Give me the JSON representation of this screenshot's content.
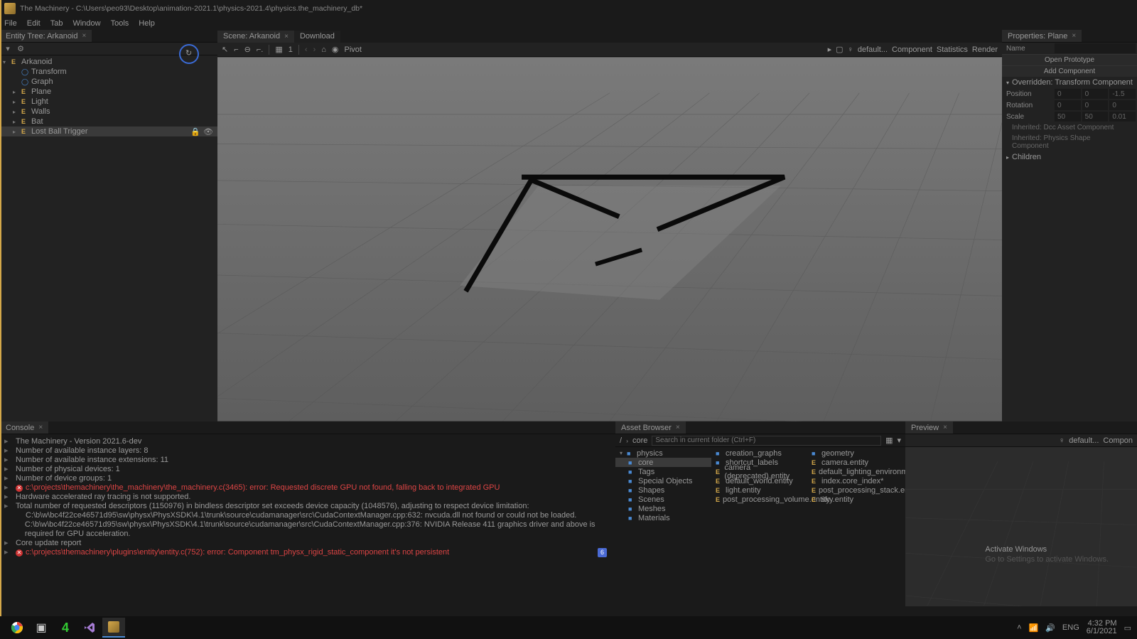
{
  "window": {
    "title": "The Machinery - C:\\Users\\peo93\\Desktop\\animation-2021.1\\physics-2021.4\\physics.the_machinery_db*"
  },
  "menu": [
    "File",
    "Edit",
    "Tab",
    "Window",
    "Tools",
    "Help"
  ],
  "entity_tree": {
    "tab_label": "Entity Tree: Arkanoid",
    "root": "Arkanoid",
    "items": [
      {
        "label": "Transform",
        "icon": "g",
        "indent": 1
      },
      {
        "label": "Graph",
        "icon": "g",
        "indent": 1
      },
      {
        "label": "Plane",
        "icon": "e",
        "indent": 1,
        "expand": true
      },
      {
        "label": "Light",
        "icon": "e",
        "indent": 1,
        "expand": true
      },
      {
        "label": "Walls",
        "icon": "e",
        "indent": 1,
        "expand": true
      },
      {
        "label": "Bat",
        "icon": "e",
        "indent": 1,
        "expand": true
      },
      {
        "label": "Lost Ball Trigger",
        "icon": "e",
        "indent": 1,
        "expand": true,
        "selected": true,
        "row_icons": true
      }
    ]
  },
  "scene": {
    "tab1": "Scene: Arkanoid",
    "tab2": "Download",
    "snap": "1",
    "pivot": "Pivot",
    "toolbar_right": [
      "default...",
      "Component",
      "Statistics",
      "Render"
    ]
  },
  "properties": {
    "tab": "Properties: Plane",
    "name_label": "Name",
    "name_value": "",
    "open_prototype": "Open Prototype",
    "add_component": "Add Component",
    "overridden": "Overridden: Transform Component",
    "fields": [
      {
        "label": "Position",
        "vals": [
          "0",
          "0",
          "-1.5"
        ]
      },
      {
        "label": "Rotation",
        "vals": [
          "0",
          "0",
          "0"
        ]
      },
      {
        "label": "Scale",
        "vals": [
          "50",
          "50",
          "0.01"
        ]
      }
    ],
    "inherited": [
      "Inherited: Dcc Asset Component",
      "Inherited: Physics Shape Component"
    ],
    "children": "Children"
  },
  "console": {
    "tab": "Console",
    "lines": [
      {
        "t": "The Machinery - Version 2021.6-dev"
      },
      {
        "t": "Number of available instance layers: 8"
      },
      {
        "t": "Number of available instance extensions: 11"
      },
      {
        "t": "Number of physical devices: 1"
      },
      {
        "t": "Number of device groups: 1"
      },
      {
        "t": "c:\\projects\\themachinery\\the_machinery\\the_machinery.c(3465): error: Requested discrete GPU not found, falling back to integrated GPU",
        "err": true
      },
      {
        "t": "Hardware accelerated ray tracing is not supported."
      },
      {
        "t": "Total number of requested descriptors (1150976) in bindless descriptor set exceeds device capacity (1048576), adjusting to respect device limitation:"
      },
      {
        "t": "C:\\b\\w\\bc4f22ce46571d95\\sw\\physx\\PhysXSDK\\4.1\\trunk\\source\\cudamanager\\src\\CudaContextManager.cpp:632: nvcuda.dll not found or could not be loaded.",
        "indent": true
      },
      {
        "t": "C:\\b\\w\\bc4f22ce46571d95\\sw\\physx\\PhysXSDK\\4.1\\trunk\\source\\cudamanager\\src\\CudaContextManager.cpp:376: NVIDIA Release 411 graphics driver and above is required for GPU acceleration.",
        "indent": true
      },
      {
        "t": "Core update report"
      },
      {
        "t": "c:\\projects\\themachinery\\plugins\\entity\\entity.c(752): error: Component tm_physx_rigid_static_component it's not persistent",
        "err": true,
        "badge": "6"
      }
    ]
  },
  "asset_browser": {
    "tab": "Asset Browser",
    "breadcrumb": [
      "/",
      "core"
    ],
    "search_placeholder": "Search in current folder (Ctrl+F)",
    "col1": [
      {
        "label": "physics",
        "type": "f",
        "expand": true
      },
      {
        "label": "core",
        "type": "f",
        "indent": 1,
        "sel": true
      },
      {
        "label": "Tags",
        "type": "f",
        "indent": 1
      },
      {
        "label": "Special Objects",
        "type": "f",
        "indent": 1
      },
      {
        "label": "Shapes",
        "type": "f",
        "indent": 1
      },
      {
        "label": "Scenes",
        "type": "f",
        "indent": 1
      },
      {
        "label": "Meshes",
        "type": "f",
        "indent": 1
      },
      {
        "label": "Materials",
        "type": "f",
        "indent": 1
      }
    ],
    "col2": [
      {
        "label": "creation_graphs",
        "type": "f"
      },
      {
        "label": "shortcut_labels",
        "type": "f"
      },
      {
        "label": "camera (deprecated).entity",
        "type": "e"
      },
      {
        "label": "default_world.entity",
        "type": "e"
      },
      {
        "label": "light.entity",
        "type": "e"
      },
      {
        "label": "post_processing_volume.entity",
        "type": "e"
      }
    ],
    "col3": [
      {
        "label": "geometry",
        "type": "f"
      },
      {
        "label": "camera.entity",
        "type": "e"
      },
      {
        "label": "default_lighting_environment.entity",
        "type": "e"
      },
      {
        "label": "index.core_index*",
        "type": "e"
      },
      {
        "label": "post_processing_stack.entity",
        "type": "e"
      },
      {
        "label": "sky.entity",
        "type": "e"
      }
    ]
  },
  "preview": {
    "tab": "Preview",
    "default": "default...",
    "compon": "Compon",
    "activate": "Activate Windows",
    "activate_sub": "Go to Settings to activate Windows."
  },
  "systray": {
    "lang": "ENG",
    "time": "4:32 PM",
    "date": "6/1/2021"
  }
}
